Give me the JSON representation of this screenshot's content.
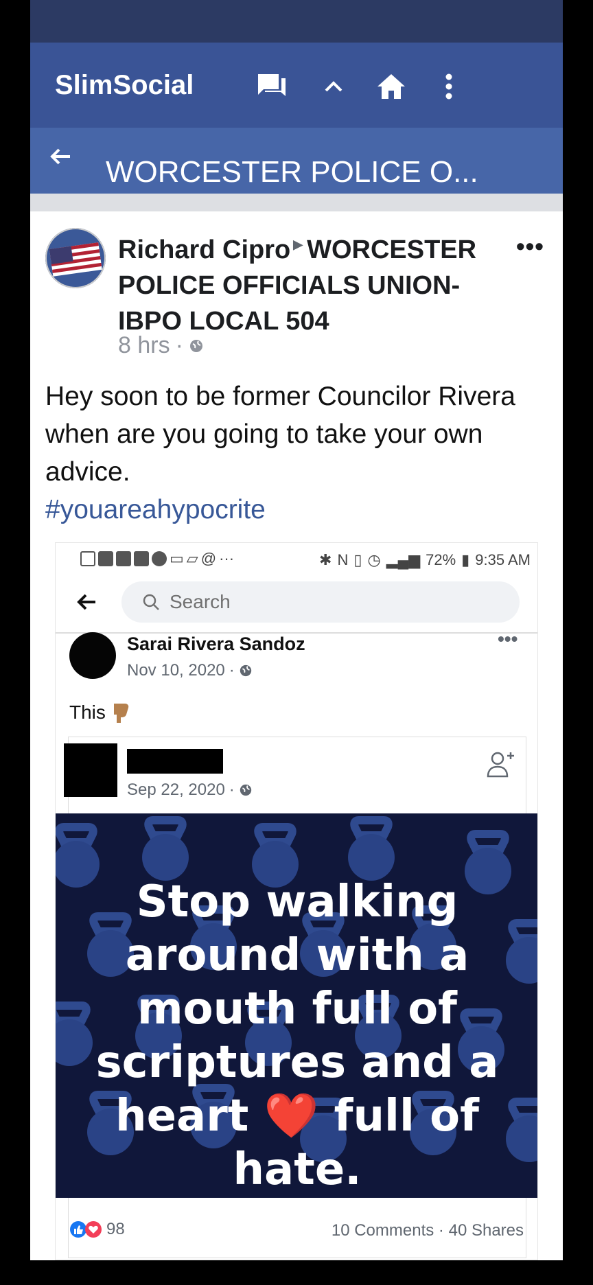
{
  "app": {
    "title": "SlimSocial"
  },
  "appbar_icons": [
    "chat-icon",
    "chevron-up-icon",
    "home-icon",
    "overflow-menu-icon"
  ],
  "colors": {
    "statusbar": "#2c3a63",
    "appbar": "#3a5496",
    "subbar": "#4766a8",
    "hashtag": "#385898"
  },
  "group": {
    "title": "WORCESTER POLICE O..."
  },
  "post": {
    "author": "Richard Cipro",
    "target": "WORCESTER POLICE OFFICIALS UNION-IBPO LOCAL 504",
    "time": "8 hrs",
    "text": "Hey soon to be former Councilor Rivera when are you going to take your own advice.",
    "hashtag": "#youareahypocrite"
  },
  "screenshot": {
    "status": {
      "battery": "72%",
      "time": "9:35 AM"
    },
    "search_placeholder": "Search",
    "inner_post": {
      "author": "Sarai Rivera Sandoz",
      "date": "Nov 10, 2020",
      "text": "This",
      "shared_date": "Sep 22, 2020",
      "meme_text": "Stop walking around with a mouth full of scriptures and a heart ❤️ full of hate."
    },
    "reactions": {
      "count": "98",
      "comments": "10 Comments",
      "shares": "40 Shares"
    }
  }
}
